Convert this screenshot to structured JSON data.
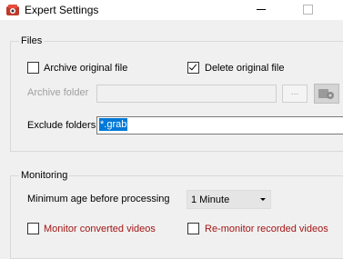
{
  "window": {
    "title": "Expert Settings",
    "icon": "expert-settings-app-icon"
  },
  "files": {
    "legend": "Files",
    "archive_original_label": "Archive original file",
    "archive_original_checked": false,
    "delete_original_label": "Delete original file",
    "delete_original_checked": true,
    "archive_folder_label": "Archive folder",
    "archive_folder_value": "",
    "browse_label": "...",
    "exclude_folders_label": "Exclude folders",
    "exclude_folders_value": "*.grab"
  },
  "monitoring": {
    "legend": "Monitoring",
    "min_age_label": "Minimum age before processing",
    "min_age_value": "1 Minute",
    "monitor_converted_label": "Monitor converted videos",
    "monitor_converted_checked": false,
    "remonitor_recorded_label": "Re-monitor recorded videos",
    "remonitor_recorded_checked": false
  },
  "colors": {
    "selection": "#0078d7",
    "warning_text": "#a31515",
    "disabled_text": "#a0a0a0"
  }
}
